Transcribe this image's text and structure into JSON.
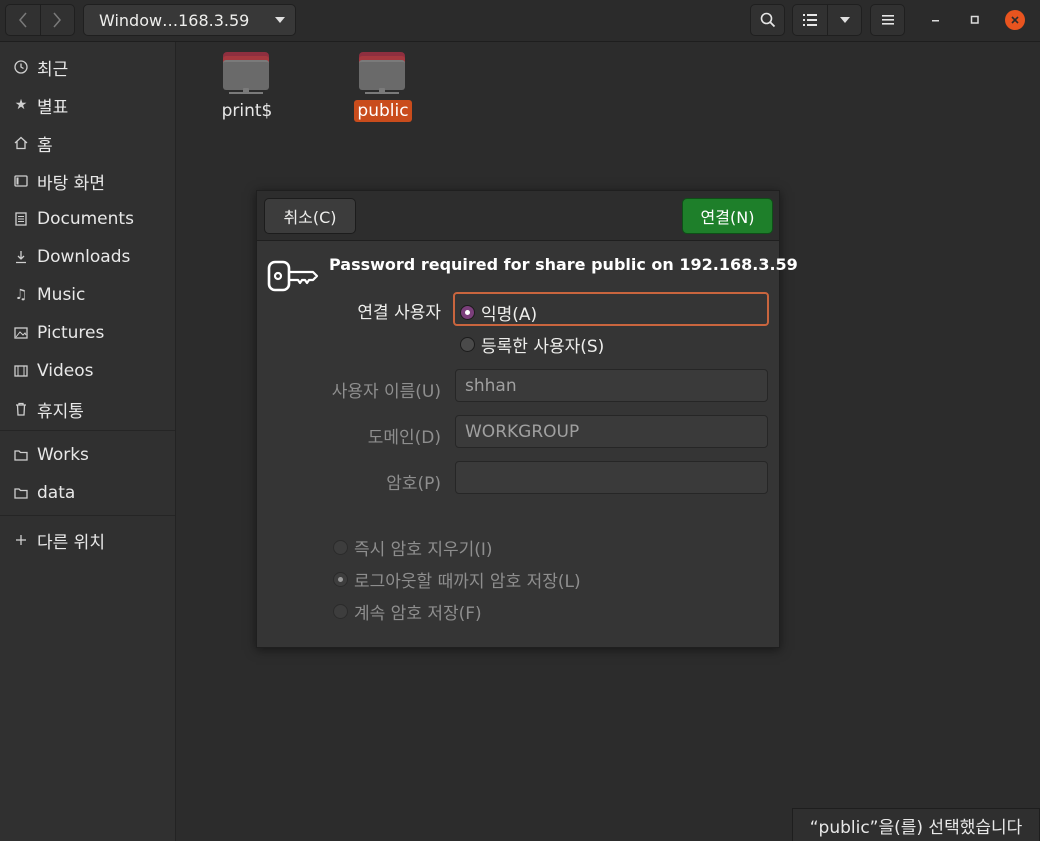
{
  "header": {
    "path_label": "Window…168.3.59",
    "back_icon": "chevron-left-icon",
    "forward_icon": "chevron-right-icon",
    "search_icon": "search-icon",
    "list_view_icon": "list-view-icon",
    "view_options_icon": "chevron-down-icon",
    "menu_icon": "hamburger-menu-icon",
    "minimize_icon": "minimize-icon",
    "maximize_icon": "maximize-icon",
    "close_icon": "close-icon"
  },
  "sidebar": {
    "items": [
      {
        "label": "최근",
        "icon": "clock-icon"
      },
      {
        "label": "별표",
        "icon": "star-icon"
      },
      {
        "label": "홈",
        "icon": "home-icon"
      },
      {
        "label": "바탕 화면",
        "icon": "desktop-icon"
      },
      {
        "label": "Documents",
        "icon": "document-icon"
      },
      {
        "label": "Downloads",
        "icon": "download-icon"
      },
      {
        "label": "Music",
        "icon": "music-icon"
      },
      {
        "label": "Pictures",
        "icon": "picture-icon"
      },
      {
        "label": "Videos",
        "icon": "video-icon"
      },
      {
        "label": "휴지통",
        "icon": "trash-icon"
      }
    ],
    "bookmarks": [
      {
        "label": "Works",
        "icon": "folder-icon"
      },
      {
        "label": "data",
        "icon": "folder-icon"
      }
    ],
    "other_locations": {
      "label": "다른 위치",
      "icon": "plus-icon"
    }
  },
  "files": [
    {
      "name": "print$",
      "selected": false
    },
    {
      "name": "public",
      "selected": true
    }
  ],
  "dialog": {
    "cancel_label": "취소(C)",
    "connect_label": "연결(N)",
    "title": "Password required for share public on 192.168.3.59",
    "connect_as_label": "연결 사용자",
    "anonymous_label": "익명(A)",
    "registered_user_label": "등록한 사용자(S)",
    "username_label": "사용자 이름(U)",
    "username_value": "shhan",
    "domain_label": "도메인(D)",
    "domain_value": "WORKGROUP",
    "password_label": "암호(P)",
    "password_value": "",
    "forget_immediately_label": "즉시 암호 지우기(I)",
    "remember_until_logout_label": "로그아웃할 때까지 암호 저장(L)",
    "remember_forever_label": "계속 암호 저장(F)"
  },
  "status": {
    "text": "“public”을(를) 선택했습니다"
  },
  "colors": {
    "accent": "#c94c1c",
    "connect_button": "#1e7f2a",
    "radio_checked": "#7b3f7b"
  }
}
